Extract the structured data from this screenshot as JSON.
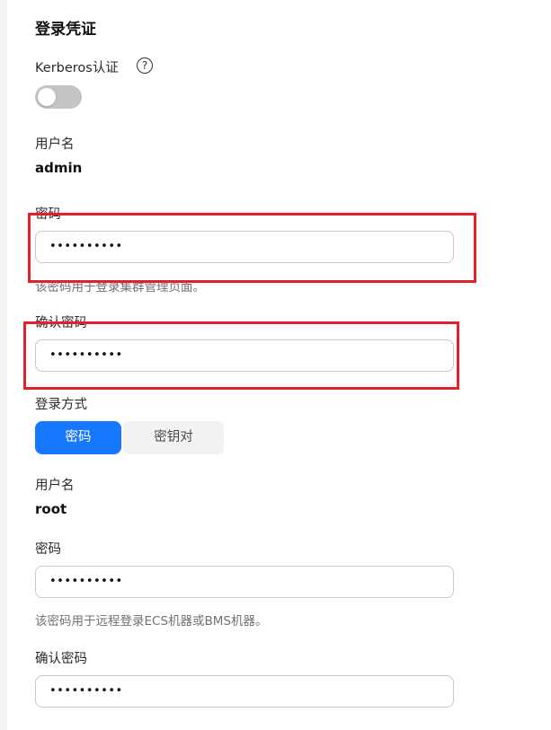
{
  "section": {
    "title": "登录凭证"
  },
  "kerberos": {
    "label": "Kerberos认证",
    "help_icon": "?",
    "enabled": false
  },
  "cluster": {
    "username_label": "用户名",
    "username_value": "admin",
    "password_label": "密码",
    "password_value": "••••••••••",
    "password_hint": "该密码用于登录集群管理页面。",
    "confirm_label": "确认密码",
    "confirm_value": "••••••••••"
  },
  "login_method": {
    "label": "登录方式",
    "options": [
      "密码",
      "密钥对"
    ],
    "selected": "密码"
  },
  "node": {
    "username_label": "用户名",
    "username_value": "root",
    "password_label": "密码",
    "password_value": "••••••••••",
    "password_hint": "该密码用于远程登录ECS机器或BMS机器。",
    "confirm_label": "确认密码",
    "confirm_value": "••••••••••"
  },
  "colors": {
    "accent": "#1677ff",
    "highlight_box": "#e3202a",
    "toggle_off": "#c4c4c4"
  }
}
